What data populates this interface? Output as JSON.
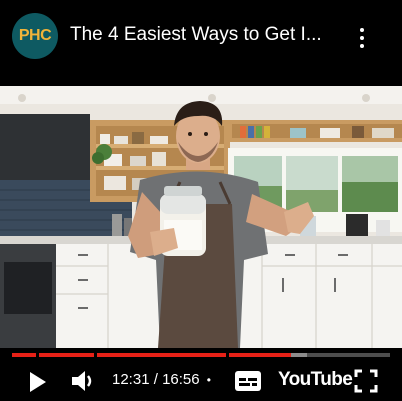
{
  "channel": {
    "logo_text": "PHC"
  },
  "video": {
    "title": "The 4 Easiest Ways to Get I..."
  },
  "player": {
    "current_time": "12:31",
    "separator": " / ",
    "duration": "16:56",
    "dot": "•",
    "brand": "YouTube",
    "progress_fraction": 0.739,
    "buffered_fraction": 0.78
  },
  "icons": {
    "menu": "more-vert-icon",
    "play": "play-icon",
    "volume": "volume-icon",
    "captions": "captions-icon",
    "fullscreen": "fullscreen-icon"
  },
  "colors": {
    "progress": "#e62117",
    "logo_bg": "#0e5a62",
    "logo_text": "#f1b43a"
  }
}
